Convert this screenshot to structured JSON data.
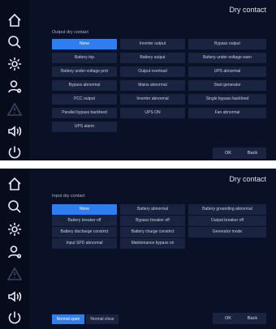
{
  "output_screen": {
    "title": "Dry contact",
    "section_label": "Output dry contact",
    "options": [
      "None",
      "Inverter output",
      "Bypass output",
      "Battery trip",
      "Battery output",
      "Battery under-voltage warn",
      "Battery under-voltage prot",
      "Output overload",
      "UPS abnormal",
      "Bypass abnormal",
      "Mains abnormal",
      "Start generator",
      "PCC output",
      "Inverter abnormal",
      "Single bypass backfeed",
      "Parallel bypass backfeed",
      "UPS ON",
      "Fan abnormal",
      "UPS alarm"
    ],
    "selected_index": 0,
    "ok_label": "OK",
    "back_label": "Back"
  },
  "input_screen": {
    "title": "Dry contact",
    "section_label": "Input dry contact",
    "options": [
      "None",
      "Battery abnormal",
      "Battery grounding abnormal",
      "Battery breaker off",
      "Bypass breaker off",
      "Output breaker off",
      "Battery discharge constrict",
      "Battery charge constrict",
      "Generator mode",
      "Input SPD abnormal",
      "Maintenance bypass on"
    ],
    "selected_index": 0,
    "mode_normal_open": "Normal open",
    "mode_normal_close": "Normal close",
    "mode_selected": "normal_open",
    "ok_label": "OK",
    "back_label": "Back"
  },
  "sidebar": {
    "icons": [
      "home-icon",
      "search-icon",
      "gear-icon",
      "user-icon",
      "warning-icon",
      "speaker-icon",
      "power-icon"
    ]
  },
  "colors": {
    "background": "#0a1126",
    "sidebar": "#070c1c",
    "button": "#1a2340",
    "selected": "#2d7ff0"
  }
}
